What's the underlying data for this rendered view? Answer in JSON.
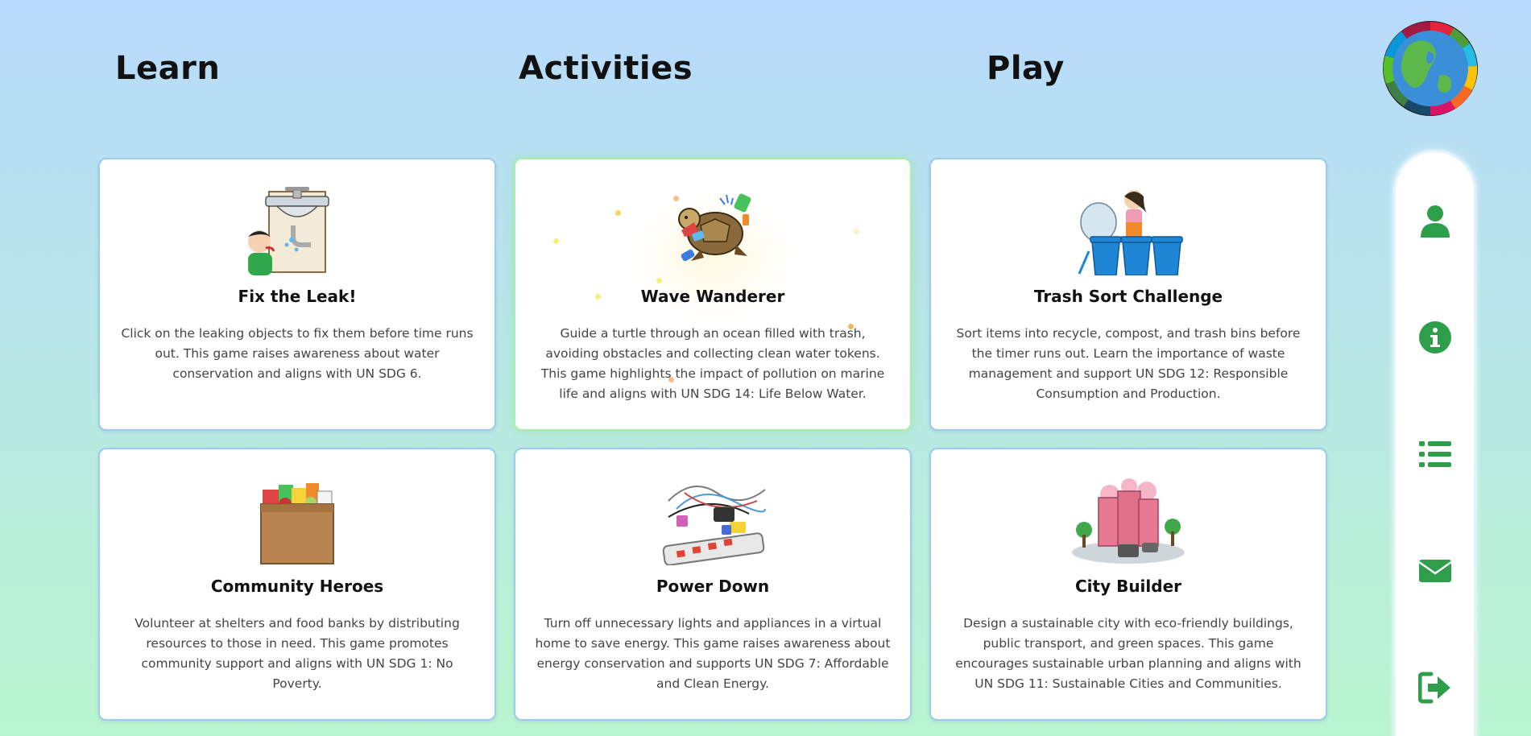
{
  "nav": {
    "learn": "Learn",
    "activities": "Activities",
    "play": "Play"
  },
  "colors": {
    "accent": "#2e9e4a",
    "card_border": "#9ccbef",
    "card_border_active": "#a9efa9",
    "bg_top": "#b8dafc",
    "bg_bottom": "#b9f5cf"
  },
  "cards": [
    {
      "title": "Fix the Leak!",
      "description": "Click on the leaking objects to fix them before time runs out. This game raises awareness about water conservation and aligns with UN SDG 6.",
      "icon": "leaking-sink-icon"
    },
    {
      "title": "Wave Wanderer",
      "description": "Guide a turtle through an ocean filled with trash, avoiding obstacles and collecting clean water tokens. This game highlights the impact of pollution on marine life and aligns with UN SDG 14: Life Below Water.",
      "icon": "turtle-trash-icon"
    },
    {
      "title": "Trash Sort Challenge",
      "description": "Sort items into recycle, compost, and trash bins before the timer runs out. Learn the importance of waste management and support UN SDG 12: Responsible Consumption and Production.",
      "icon": "trash-bins-icon"
    },
    {
      "title": "Community Heroes",
      "description": "Volunteer at shelters and food banks by distributing resources to those in need. This game promotes community support and aligns with UN SDG 1: No Poverty.",
      "icon": "donation-box-icon"
    },
    {
      "title": "Power Down",
      "description": "Turn off unnecessary lights and appliances in a virtual home to save energy. This game raises awareness about energy conservation and supports UN SDG 7: Affordable and Clean Energy.",
      "icon": "power-strip-icon"
    },
    {
      "title": "City Builder",
      "description": "Design a sustainable city with eco-friendly buildings, public transport, and green spaces. This game encourages sustainable urban planning and aligns with UN SDG 11: Sustainable Cities and Communities.",
      "icon": "city-icon"
    }
  ],
  "sidebar": [
    {
      "icon": "user-icon"
    },
    {
      "icon": "info-icon"
    },
    {
      "icon": "list-icon"
    },
    {
      "icon": "envelope-icon"
    },
    {
      "icon": "logout-icon"
    }
  ]
}
